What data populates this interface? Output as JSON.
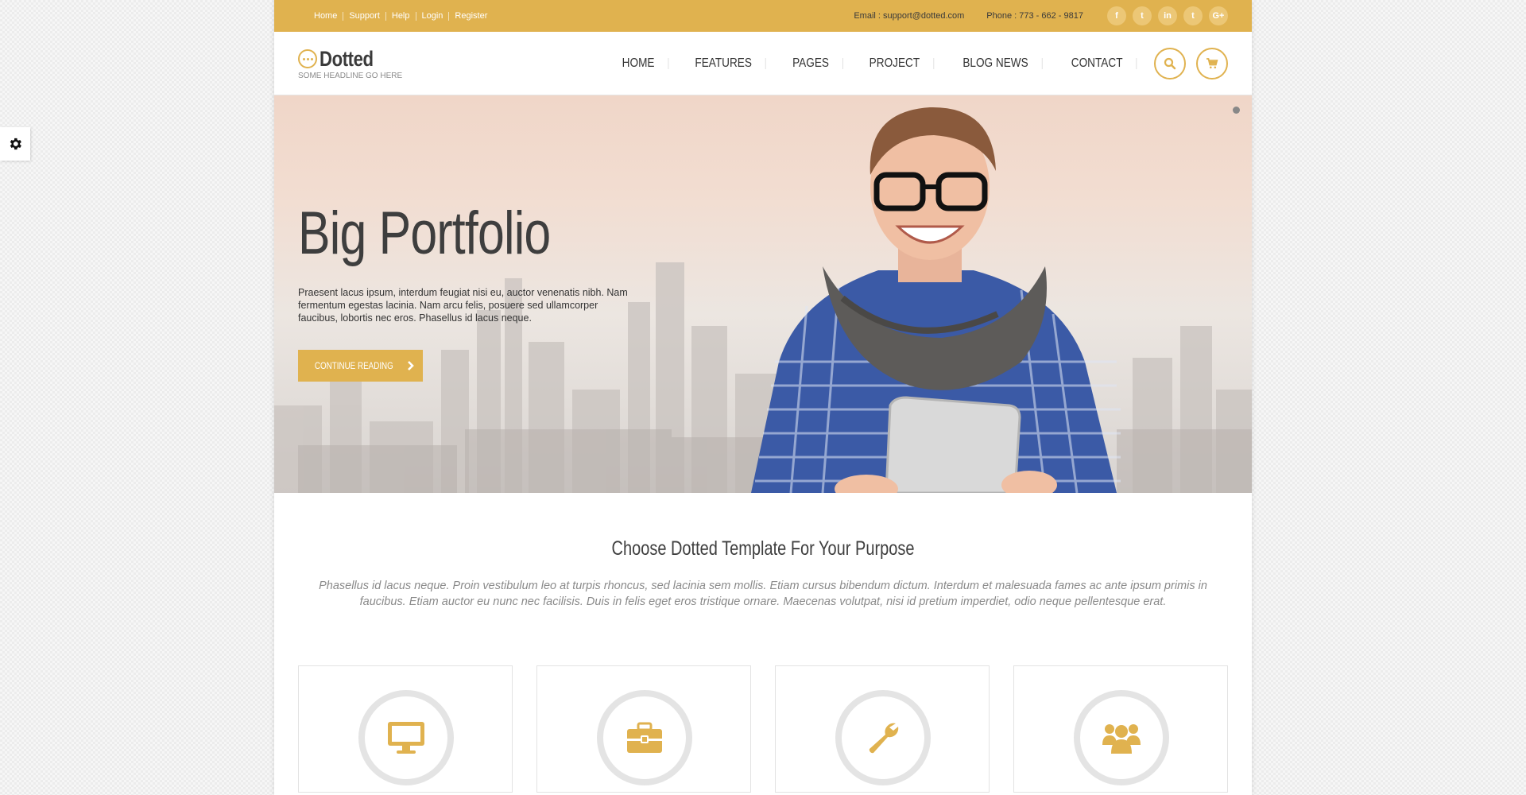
{
  "colors": {
    "accent": "#e0b24f",
    "text_dark": "#3e3e3e",
    "muted": "#8a8a8a"
  },
  "topbar": {
    "links": [
      "Home",
      "Support",
      "Help",
      "Login",
      "Register"
    ],
    "email": "Email : support@dotted.com",
    "phone": "Phone : 773 - 662 - 9817",
    "socials": [
      {
        "icon": "facebook-icon",
        "glyph": "f"
      },
      {
        "icon": "twitter-icon",
        "glyph": "t"
      },
      {
        "icon": "linkedin-icon",
        "glyph": "in"
      },
      {
        "icon": "tumblr-icon",
        "glyph": "t"
      },
      {
        "icon": "google-plus-icon",
        "glyph": "G+"
      }
    ]
  },
  "header": {
    "logo_name": "Dotted",
    "logo_tagline": "SOME HEADLINE GO HERE",
    "nav": [
      "HOME",
      "FEATURES",
      "PAGES",
      "PROJECT",
      "BLOG NEWS",
      "CONTACT"
    ]
  },
  "hero": {
    "title": "Big Portfolio",
    "text": "Praesent lacus ipsum, interdum feugiat nisi eu, auctor venenatis nibh. Nam fermentum egestas lacinia. Nam arcu felis, posuere sed ullamcorper faucibus, lobortis nec eros. Phasellus id lacus neque.",
    "button": "CONTINUE READING"
  },
  "intro": {
    "heading": "Choose Dotted Template For Your Purpose",
    "text": "Phasellus id lacus neque. Proin vestibulum leo at turpis rhoncus, sed lacinia sem mollis. Etiam cursus bibendum dictum. Interdum et malesuada fames ac ante ipsum primis in faucibus. Etiam auctor eu nunc nec facilisis. Duis in felis eget eros tristique ornare. Maecenas volutpat, nisi id pretium imperdiet, odio neque pellentesque erat."
  },
  "features": [
    {
      "icon": "monitor-icon"
    },
    {
      "icon": "briefcase-icon"
    },
    {
      "icon": "wrench-icon"
    },
    {
      "icon": "users-icon"
    }
  ]
}
